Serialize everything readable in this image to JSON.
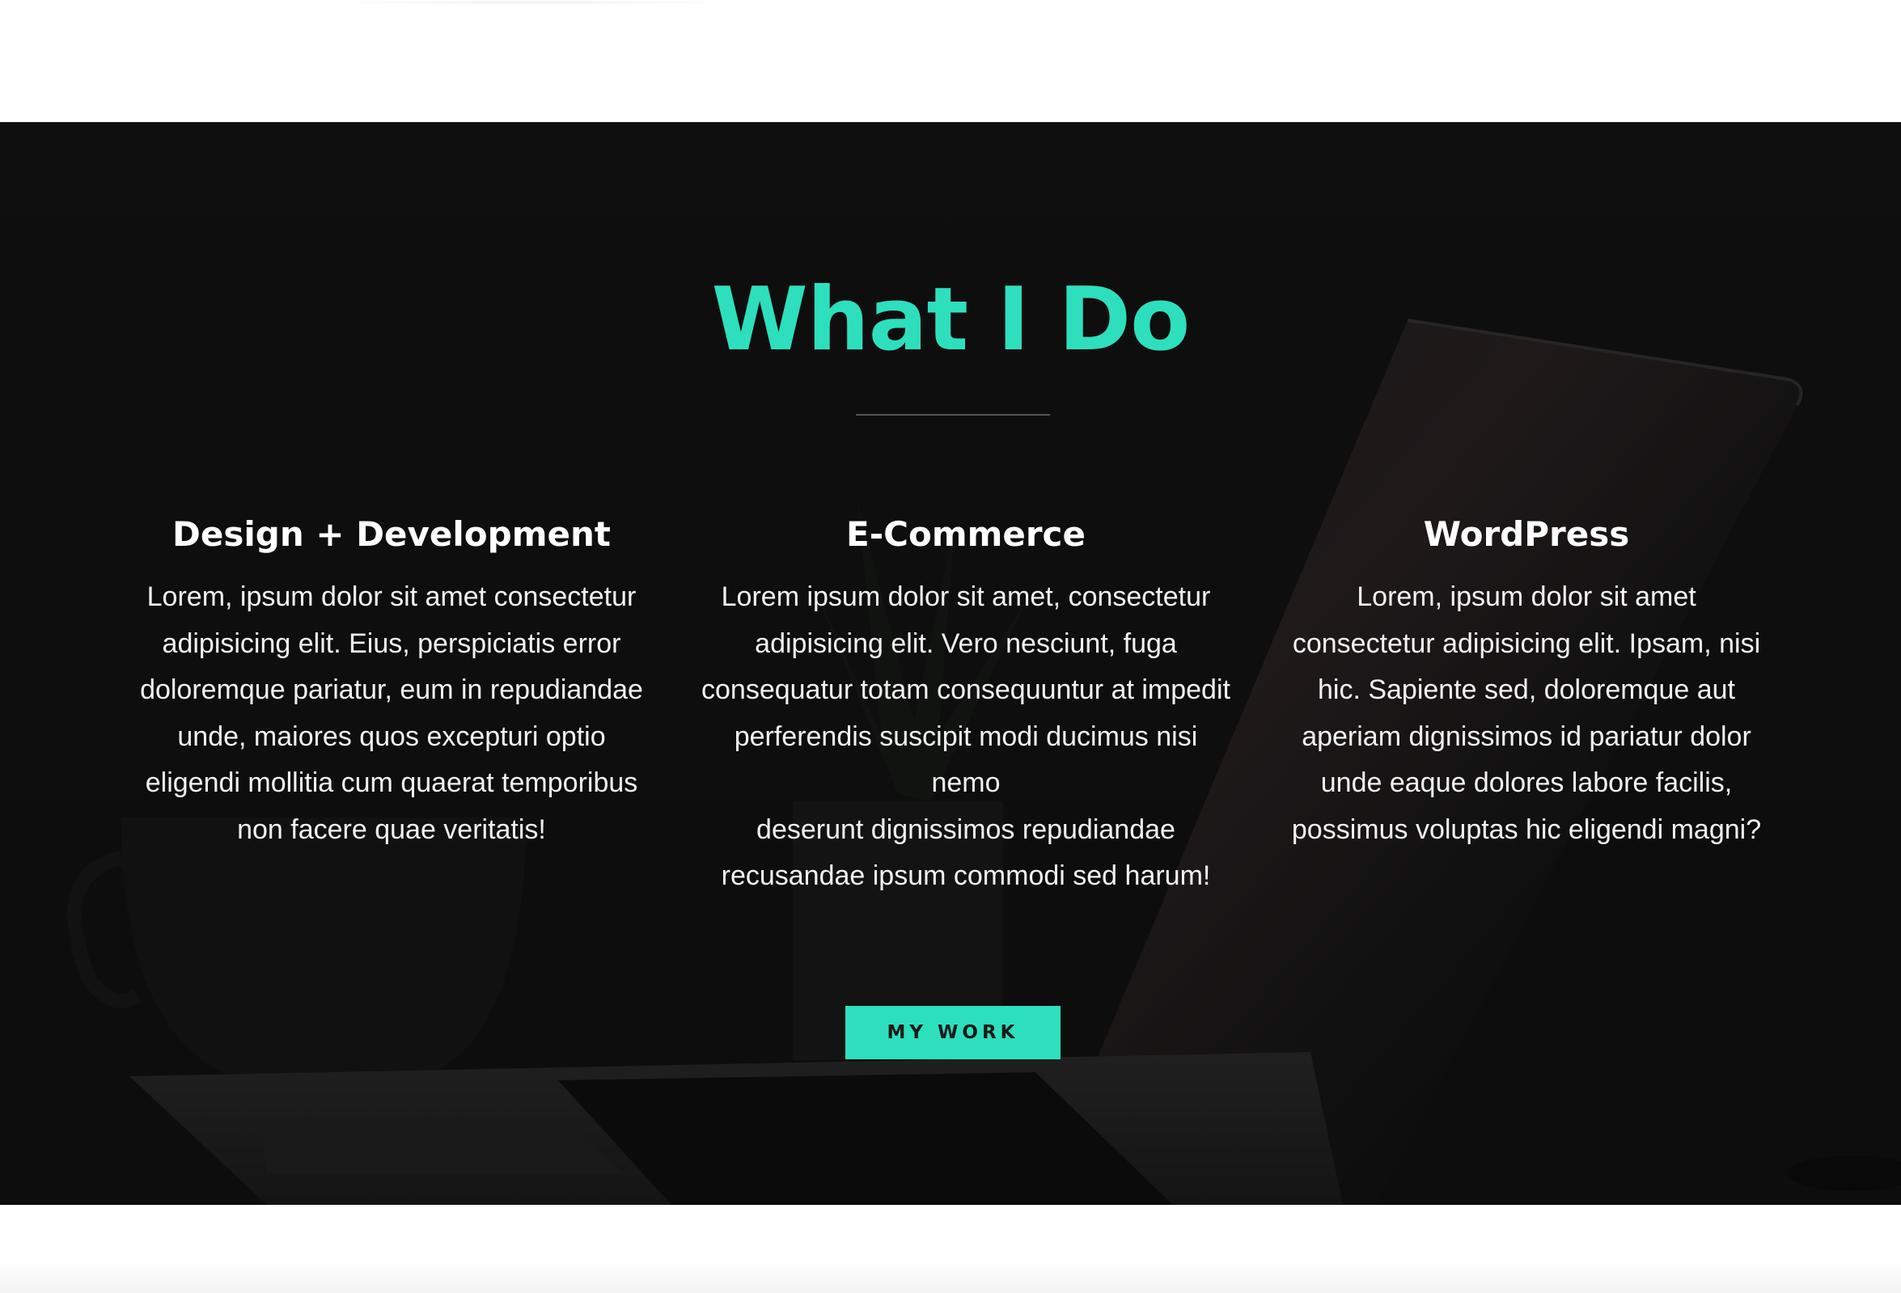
{
  "section": {
    "title": "What I Do",
    "services": [
      {
        "heading": "Design + Development",
        "lines": [
          "Lorem, ipsum dolor sit amet consectetur",
          "adipisicing elit. Eius, perspiciatis error",
          "doloremque pariatur, eum in repudiandae",
          "unde, maiores quos excepturi optio",
          "eligendi mollitia cum quaerat temporibus",
          "non facere quae veritatis!"
        ]
      },
      {
        "heading": "E-Commerce",
        "lines": [
          "Lorem ipsum dolor sit amet, consectetur",
          "adipisicing elit. Vero nesciunt, fuga",
          "consequatur totam consequuntur at impedit",
          "perferendis suscipit modi ducimus nisi nemo",
          "deserunt dignissimos repudiandae",
          "recusandae ipsum commodi sed harum!"
        ]
      },
      {
        "heading": "WordPress",
        "lines": [
          "Lorem, ipsum dolor sit amet",
          "consectetur adipisicing elit. Ipsam, nisi",
          "hic. Sapiente sed, doloremque aut",
          "aperiam dignissimos id pariatur dolor",
          "unde eaque dolores labore facilis,",
          "possimus voluptas hic eligendi magni?"
        ]
      }
    ],
    "button_label": "MY WORK"
  },
  "colors": {
    "accent": "#2ddfbc",
    "section_background": "#1a1a1a",
    "heading_text": "#ffffff",
    "body_text": "#f2f2f2",
    "button_text": "#1a1a1a"
  }
}
